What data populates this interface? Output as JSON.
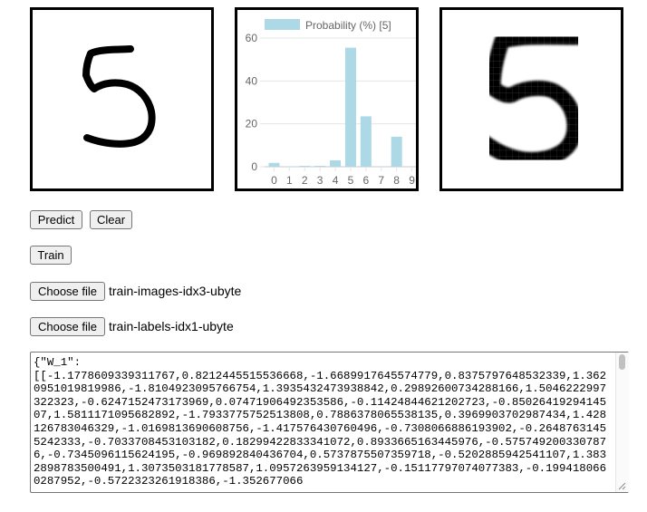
{
  "buttons": {
    "predict": "Predict",
    "clear": "Clear",
    "train": "Train",
    "choose_file_images": "Choose file",
    "choose_file_labels": "Choose file"
  },
  "files": {
    "images": "train-images-idx3-ubyte",
    "labels": "train-labels-idx1-ubyte"
  },
  "weights_text": "{\"W_1\":\n[[-1.1778609339311767,0.8212445515536668,-1.6689917645574779,0.8375797648532339,1.3620951019819986,-1.8104923095766754,1.3935432473938842,0.29892600734288166,1.5046222997322323,-0.6247152473173969,0.07471906492353586,-0.11424844621202723,-0.8502641929414507,1.5811171095682892,-1.7933775752513808,0.7886378065538135,0.3969903702987434,1.428126783046329,-1.0169813690608756,-1.417576430760496,-0.7308066886193902,-0.26487631455242333,-0.7033708453103182,0.18299422833341072,0.8933665163445976,-0.5757492003307876,-0.7345096115624195,-0.969892840436704,0.5737875507359718,-0.5202885942541107,1.3832898783500491,1.3073503181778587,1.0957263959134127,-0.15117797074077383,-0.1994180660287952,-0.5722323261918386,-1.352677066",
  "chart_data": {
    "type": "bar",
    "categories": [
      "0",
      "1",
      "2",
      "3",
      "4",
      "5",
      "6",
      "7",
      "8",
      "9"
    ],
    "series": [
      {
        "name": "Probability (%) [5]",
        "values": [
          1.8,
          0.2,
          0.4,
          0.4,
          3.0,
          55.5,
          23.5,
          0.1,
          14.0,
          0.1
        ]
      }
    ],
    "yticks": [
      "0",
      "20",
      "40",
      "60"
    ],
    "ylim": [
      0,
      60
    ],
    "color": "#add8e6",
    "legend_position": "top",
    "grid": true
  },
  "canvas_icon": "handwritten-digit-5",
  "preview_icon": "pixelated-digit-5"
}
